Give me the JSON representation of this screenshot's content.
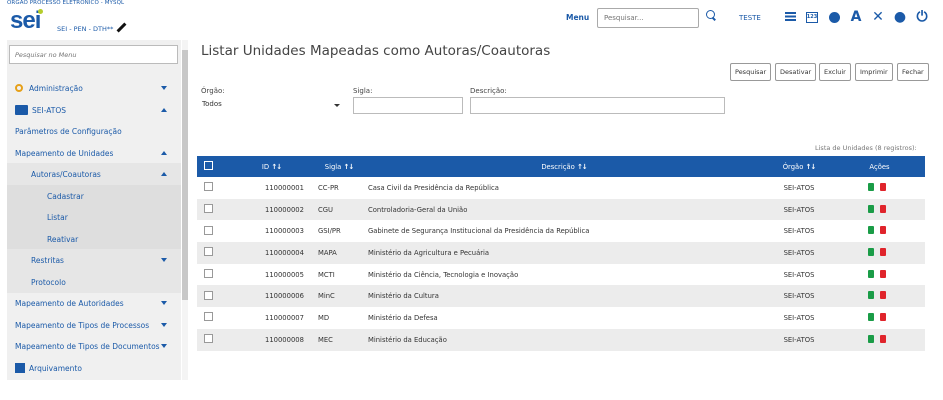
{
  "header": {
    "org_title": "ORGAO PROCESSO ELETRONICO - MYSQL",
    "logo": "sei",
    "subsystem": "SEI - PEN - DTH**",
    "menu_label": "Menu",
    "search_placeholder": "Pesquisar...",
    "user": "TESTE",
    "icons": [
      "grid-icon",
      "numeric-box-icon",
      "puzzle-icon",
      "font-icon",
      "tools-icon",
      "user-icon",
      "power-icon"
    ]
  },
  "sidebar": {
    "search_placeholder": "Pesquisar no Menu",
    "items": [
      {
        "label": "Administração",
        "icon": "gear-icon"
      },
      {
        "label": "SEI-ATOS",
        "icon": "folder-icon"
      },
      {
        "label": "Parâmetros de Configuração"
      },
      {
        "label": "Mapeamento de Unidades"
      },
      {
        "label": "Autoras/Coautoras"
      },
      {
        "label": "Cadastrar"
      },
      {
        "label": "Listar"
      },
      {
        "label": "Reativar"
      },
      {
        "label": "Restritas"
      },
      {
        "label": "Protocolo"
      },
      {
        "label": "Mapeamento de Autoridades"
      },
      {
        "label": "Mapeamento de Tipos de Processos"
      },
      {
        "label": "Mapeamento de Tipos de Documentos"
      },
      {
        "label": "Arquivamento",
        "icon": "archive-icon"
      }
    ]
  },
  "main": {
    "title": "Listar Unidades Mapeadas como Autoras/Coautoras",
    "buttons": [
      "Pesquisar",
      "Desativar",
      "Excluir",
      "Imprimir",
      "Fechar"
    ],
    "filters": {
      "orgao_label": "Órgão:",
      "orgao_value": "Todos",
      "sigla_label": "Sigla:",
      "descricao_label": "Descrição:"
    },
    "table_caption": "Lista de Unidades (8 registros):",
    "columns": [
      "ID",
      "Sigla",
      "Descrição",
      "Órgão",
      "Ações"
    ],
    "rows": [
      {
        "id": "110000001",
        "sigla": "CC-PR",
        "descricao": "Casa Civil da Presidência da República",
        "orgao": "SEI-ATOS"
      },
      {
        "id": "110000002",
        "sigla": "CGU",
        "descricao": "Controladoria-Geral da União",
        "orgao": "SEI-ATOS"
      },
      {
        "id": "110000003",
        "sigla": "GSI/PR",
        "descricao": "Gabinete de Segurança Institucional da Presidência da República",
        "orgao": "SEI-ATOS"
      },
      {
        "id": "110000004",
        "sigla": "MAPA",
        "descricao": "Ministério da Agricultura e Pecuária",
        "orgao": "SEI-ATOS"
      },
      {
        "id": "110000005",
        "sigla": "MCTI",
        "descricao": "Ministério da Ciência, Tecnologia e Inovação",
        "orgao": "SEI-ATOS"
      },
      {
        "id": "110000006",
        "sigla": "MinC",
        "descricao": "Ministério da Cultura",
        "orgao": "SEI-ATOS"
      },
      {
        "id": "110000007",
        "sigla": "MD",
        "descricao": "Ministério da Defesa",
        "orgao": "SEI-ATOS"
      },
      {
        "id": "110000008",
        "sigla": "MEC",
        "descricao": "Ministério da Educação",
        "orgao": "SEI-ATOS"
      }
    ]
  }
}
